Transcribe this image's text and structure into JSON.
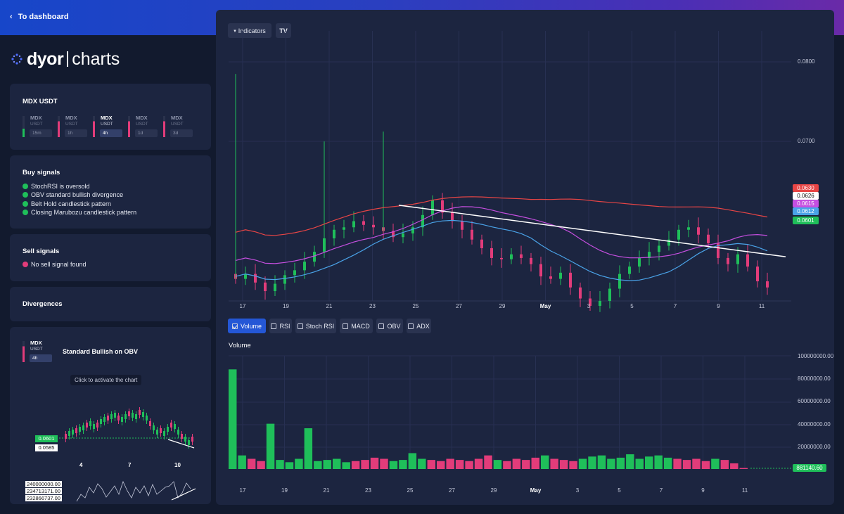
{
  "topbar": {
    "back_link": "To dashboard"
  },
  "logo": {
    "brand": "dyor",
    "product": "charts"
  },
  "pair_card": {
    "title": "MDX USDT",
    "timeframes": [
      {
        "symbol": "MDX",
        "quote": "USDT",
        "label": "15m",
        "trend": "pos",
        "active": false
      },
      {
        "symbol": "MDX",
        "quote": "USDT",
        "label": "1h",
        "trend": "neg",
        "active": false
      },
      {
        "symbol": "MDX",
        "quote": "USDT",
        "label": "4h",
        "trend": "neg",
        "active": true
      },
      {
        "symbol": "MDX",
        "quote": "USDT",
        "label": "1d",
        "trend": "neg",
        "active": false
      },
      {
        "symbol": "MDX",
        "quote": "USDT",
        "label": "3d",
        "trend": "neg",
        "active": false
      }
    ]
  },
  "buy_signals": {
    "title": "Buy signals",
    "items": [
      "StochRSI is oversold",
      "OBV standard bullish divergence",
      "Belt Hold candlestick pattern",
      "Closing Marubozu candlestick pattern"
    ]
  },
  "sell_signals": {
    "title": "Sell signals",
    "items": [
      "No sell signal found"
    ]
  },
  "divergences": {
    "title": "Divergences",
    "symbol": "MDX",
    "quote": "USDT",
    "timeframe": "4h",
    "heading": "Standard Bullish on OBV",
    "hint": "Click to activate the chart",
    "price_tags": [
      "0.0601",
      "0.0585"
    ],
    "x_ticks": [
      "4",
      "7",
      "10"
    ],
    "obv_tags": [
      "240000000.00",
      "234713171.00",
      "232866737.00"
    ]
  },
  "toolbar": {
    "indicators_label": "Indicators",
    "tv_logo": "tradingview-logo"
  },
  "price_chart": {
    "y_ticks": [
      "0.0800",
      "0.0700"
    ],
    "x_ticks": [
      "17",
      "19",
      "21",
      "23",
      "25",
      "27",
      "29",
      "May",
      "3",
      "5",
      "7",
      "9",
      "11"
    ],
    "tags": [
      {
        "value": "0.0630",
        "color": "#e84545"
      },
      {
        "value": "0.0626",
        "color": "#ffffff"
      },
      {
        "value": "0.0615",
        "color": "#c64fe0"
      },
      {
        "value": "0.0612",
        "color": "#4aa3e8"
      },
      {
        "value": "0.0601",
        "color": "#1fbf5a"
      }
    ]
  },
  "indicator_tabs": [
    {
      "label": "Volume",
      "active": true
    },
    {
      "label": "RSI",
      "active": false
    },
    {
      "label": "Stoch RSI",
      "active": false
    },
    {
      "label": "MACD",
      "active": false
    },
    {
      "label": "OBV",
      "active": false
    },
    {
      "label": "ADX",
      "active": false
    }
  ],
  "volume_chart": {
    "title": "Volume",
    "y_ticks": [
      "100000000.00",
      "80000000.00",
      "60000000.00",
      "40000000.00",
      "20000000.00"
    ],
    "x_ticks": [
      "17",
      "19",
      "21",
      "23",
      "25",
      "27",
      "29",
      "May",
      "3",
      "5",
      "7",
      "9",
      "11"
    ],
    "last_value": "881140.60"
  },
  "chart_data": {
    "type": "candlestick",
    "pair": "MDX/USDT",
    "timeframe": "4h",
    "x": [
      "17",
      "19",
      "21",
      "23",
      "25",
      "27",
      "29",
      "May",
      "3",
      "5",
      "7",
      "9",
      "11"
    ],
    "close_series": [
      0.0608,
      0.0612,
      0.0605,
      0.0598,
      0.0604,
      0.0611,
      0.0615,
      0.0622,
      0.063,
      0.0641,
      0.0648,
      0.065,
      0.0655,
      0.0652,
      0.065,
      0.0647,
      0.0642,
      0.0645,
      0.065,
      0.066,
      0.0672,
      0.0662,
      0.0655,
      0.0648,
      0.064,
      0.0633,
      0.0625,
      0.0624,
      0.0628,
      0.0625,
      0.062,
      0.061,
      0.0608,
      0.0613,
      0.0601,
      0.0592,
      0.0586,
      0.059,
      0.06,
      0.0612,
      0.0618,
      0.0625,
      0.063,
      0.0635,
      0.064,
      0.0648,
      0.065,
      0.0644,
      0.0637,
      0.0625,
      0.062,
      0.0628,
      0.0618,
      0.0606,
      0.0601
    ],
    "overlays": [
      {
        "name": "MA red",
        "color": "#e84545",
        "last": 0.063
      },
      {
        "name": "MA purple",
        "color": "#c64fe0",
        "last": 0.0615
      },
      {
        "name": "MA blue",
        "color": "#4aa3e8",
        "last": 0.0612
      },
      {
        "name": "Trendline",
        "color": "#ffffff",
        "last": 0.0626
      }
    ],
    "ylim": [
      0.059,
      0.081
    ],
    "volume": [
      88000000,
      12000000,
      9000000,
      7000000,
      40000000,
      8000000,
      6000000,
      9000000,
      36000000,
      7000000,
      8000000,
      9000000,
      6000000,
      7000000,
      8000000,
      10000000,
      9000000,
      7000000,
      8000000,
      14000000,
      9000000,
      8000000,
      7000000,
      9000000,
      8000000,
      7000000,
      9000000,
      12000000,
      8000000,
      7000000,
      9000000,
      8000000,
      10000000,
      12000000,
      9000000,
      8000000,
      7000000,
      9000000,
      11000000,
      12000000,
      9000000,
      10000000,
      13000000,
      9000000,
      11000000,
      12000000,
      10000000,
      9000000,
      8000000,
      9000000,
      7000000,
      9000000,
      8000000,
      5000000,
      881140.6
    ]
  }
}
